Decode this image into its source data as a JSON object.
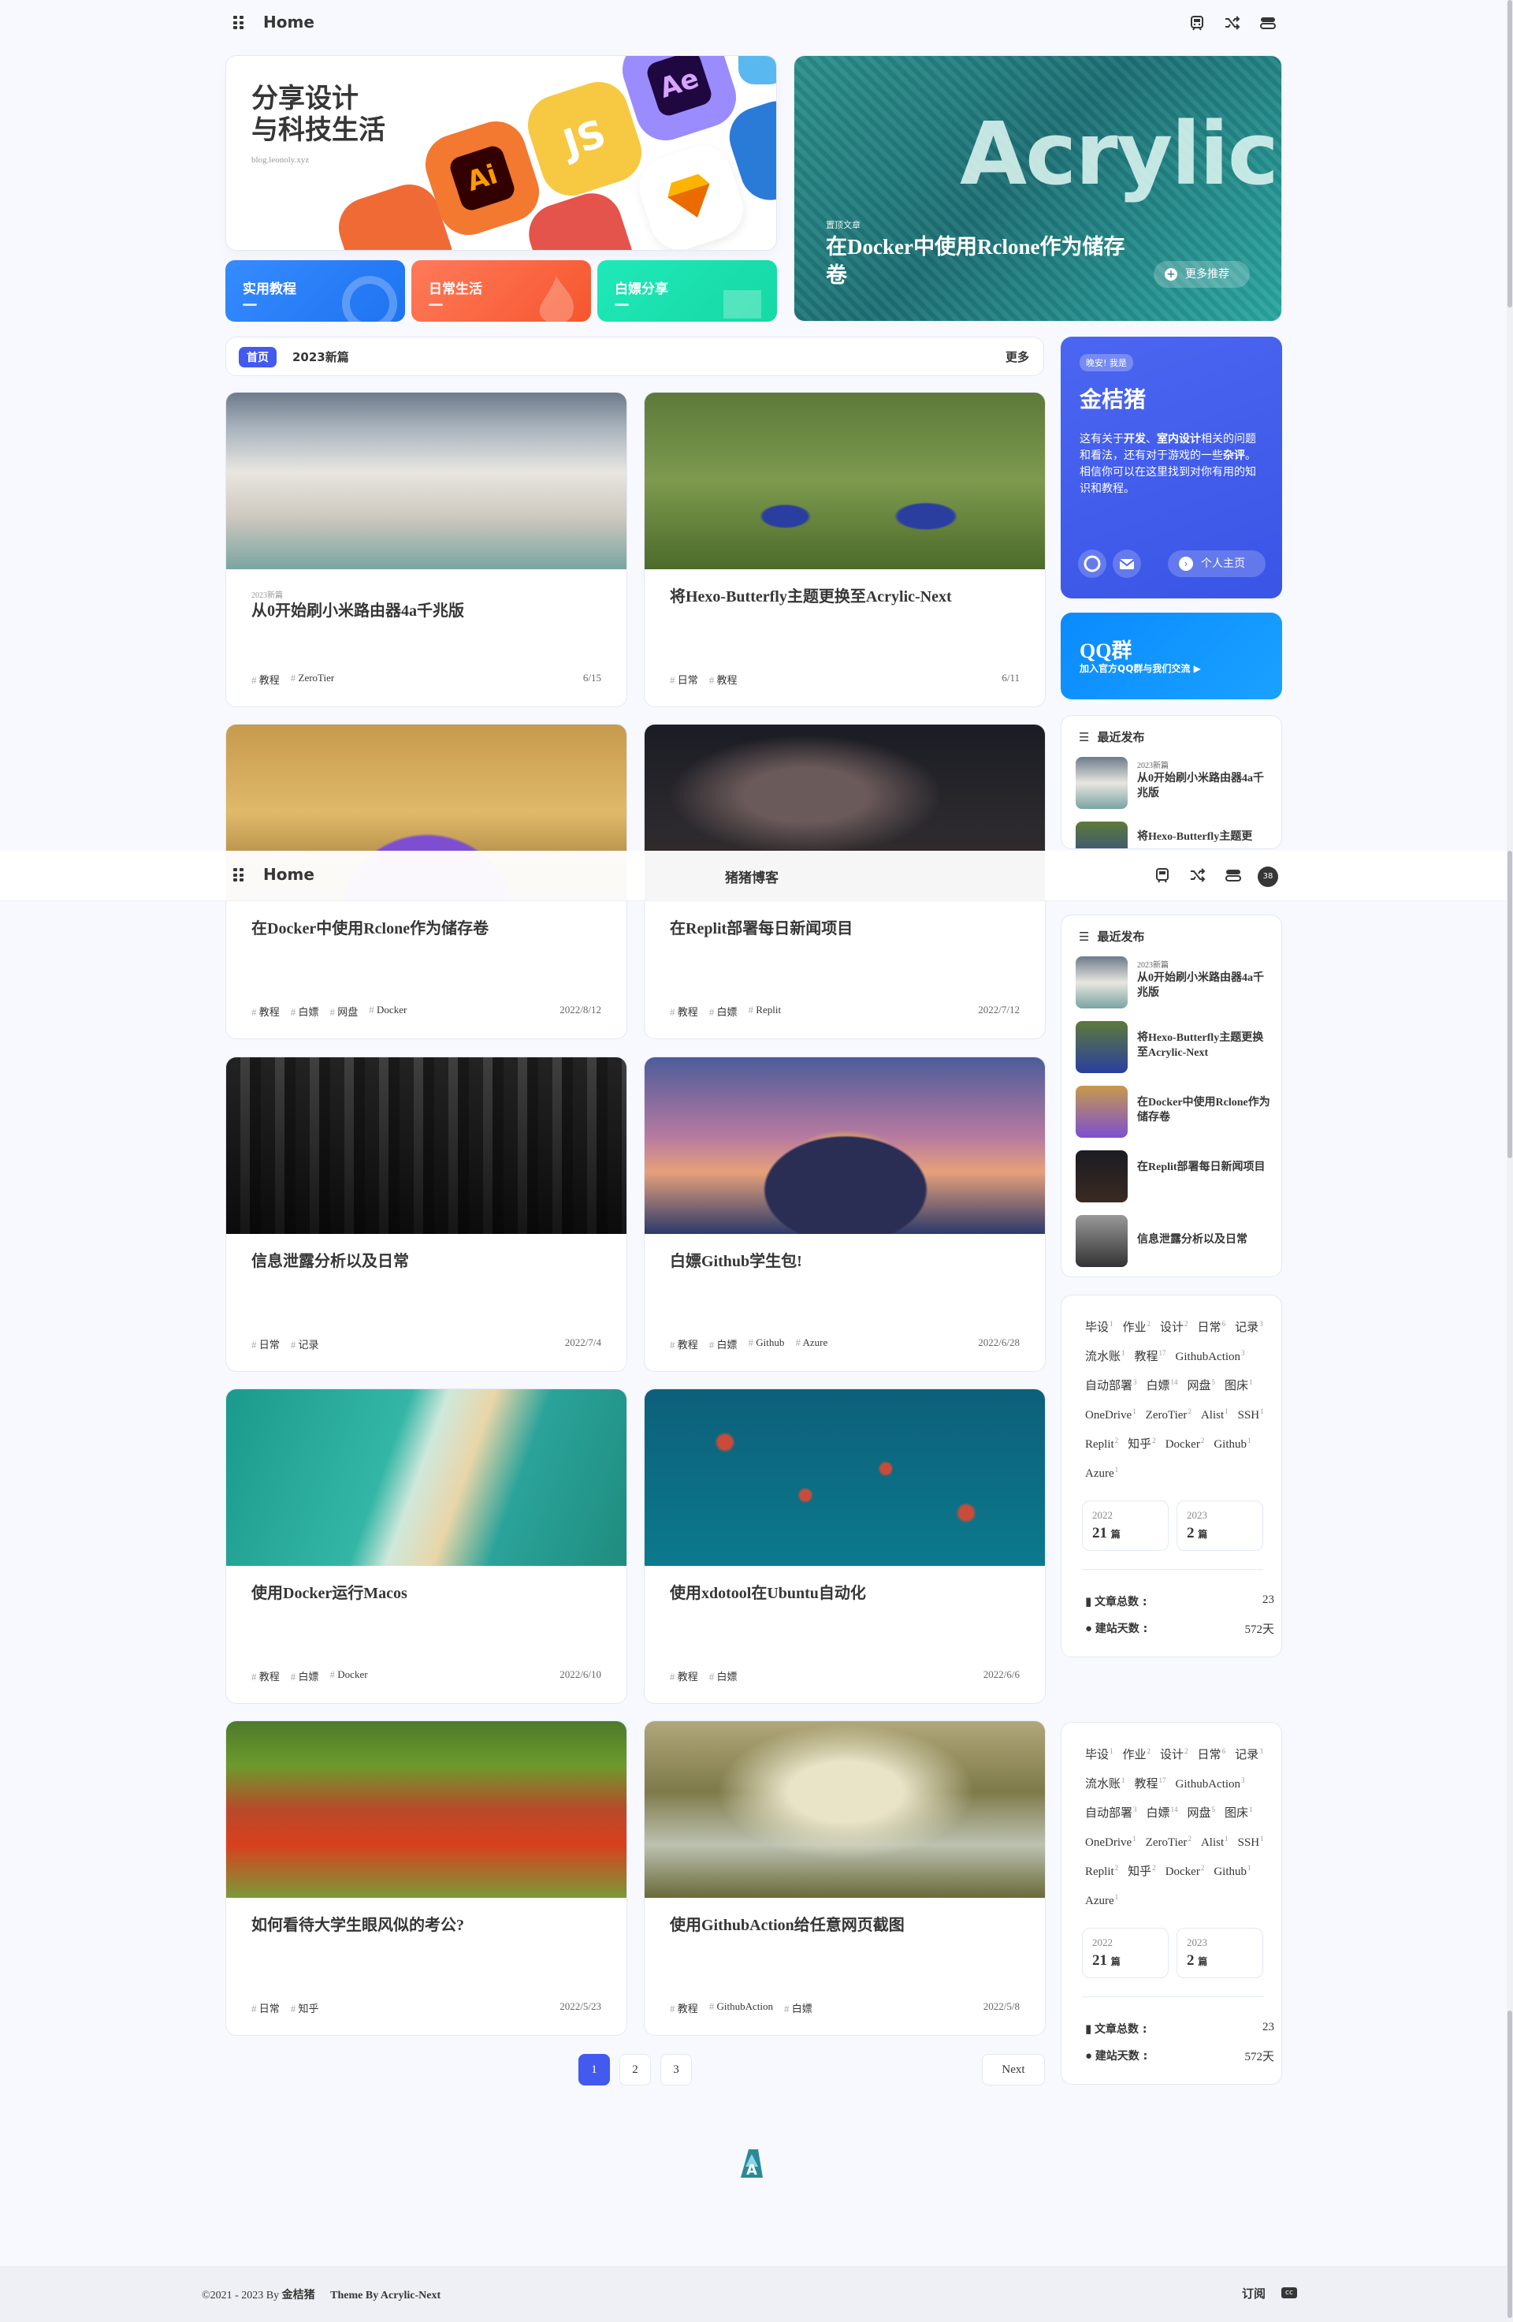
{
  "nav": {
    "brand": "Home",
    "center_title": "猪猪博客",
    "avatar_badge": "38"
  },
  "hero": {
    "title_line1": "分享设计",
    "title_line2": "与科技生活",
    "url": "blog.leonoly.xyz",
    "apps": [
      "Ai",
      "JS",
      "Ae"
    ],
    "categories": [
      "实用教程",
      "日常生活",
      "白嫖分享"
    ]
  },
  "featured": {
    "label": "置顶文章",
    "title": "在Docker中使用Rclone作为储存卷",
    "more_button": "更多推荐",
    "watermark": "Acrylic"
  },
  "catbar": {
    "home": "首页",
    "current": "2023新篇",
    "more": "更多"
  },
  "posts": [
    {
      "category": "2023新篇",
      "title": "从0开始刷小米路由器4a千兆版",
      "tags": [
        "教程",
        "ZeroTier"
      ],
      "date": "6/15"
    },
    {
      "category": "",
      "title": "将Hexo-Butterfly主题更换至Acrylic-Next",
      "tags": [
        "日常",
        "教程"
      ],
      "date": "6/11"
    },
    {
      "category": "",
      "title": "在Docker中使用Rclone作为储存卷",
      "tags": [
        "教程",
        "白嫖",
        "网盘",
        "Docker"
      ],
      "date": "2022/8/12"
    },
    {
      "category": "",
      "title": "在Replit部署每日新闻项目",
      "tags": [
        "教程",
        "白嫖",
        "Replit"
      ],
      "date": "2022/7/12"
    },
    {
      "category": "",
      "title": "信息泄露分析以及日常",
      "tags": [
        "日常",
        "记录"
      ],
      "date": "2022/7/4"
    },
    {
      "category": "",
      "title": "白嫖Github学生包!",
      "tags": [
        "教程",
        "白嫖",
        "Github",
        "Azure"
      ],
      "date": "2022/6/28"
    },
    {
      "category": "",
      "title": "使用Docker运行Macos",
      "tags": [
        "教程",
        "白嫖",
        "Docker"
      ],
      "date": "2022/6/10"
    },
    {
      "category": "",
      "title": "使用xdotool在Ubuntu自动化",
      "tags": [
        "教程",
        "白嫖"
      ],
      "date": "2022/6/6"
    },
    {
      "category": "",
      "title": "如何看待大学生眼风似的考公?",
      "tags": [
        "日常",
        "知乎"
      ],
      "date": "2022/5/23"
    },
    {
      "category": "",
      "title": "使用GithubAction给任意网页截图",
      "tags": [
        "教程",
        "GithubAction",
        "白嫖"
      ],
      "date": "2022/5/8"
    }
  ],
  "author": {
    "greeting": "晚安! 我是",
    "name": "金桔猪",
    "desc_1": "这有关于",
    "desc_bold1": "开发",
    "desc_2": "、",
    "desc_bold2": "室内设计",
    "desc_3": "相关的问题和看法，还有对于游戏的一些",
    "desc_bold3": "杂评",
    "desc_4": "。",
    "desc_5": "相信你可以在这里找到对你有用的知识和教程。",
    "home_button": "个人主页"
  },
  "qq": {
    "title": "QQ群",
    "subtitle": "加入官方QQ群与我们交流 ▶"
  },
  "recent": {
    "title": "最近发布",
    "items": [
      {
        "category": "2023新篇",
        "title": "从0开始刷小米路由器4a千兆版"
      },
      {
        "category": "",
        "title": "将Hexo-Butterfly主题更换至Acrylic-Next"
      },
      {
        "category": "",
        "title": "在Docker中使用Rclone作为储存卷"
      },
      {
        "category": "",
        "title": "在Replit部署每日新闻项目"
      },
      {
        "category": "",
        "title": "信息泄露分析以及日常"
      }
    ],
    "partial_title_top": "将Hexo-Butterfly主题更"
  },
  "tags": [
    {
      "name": "毕设",
      "count": "1"
    },
    {
      "name": "作业",
      "count": "2"
    },
    {
      "name": "设计",
      "count": "2"
    },
    {
      "name": "日常",
      "count": "6"
    },
    {
      "name": "记录",
      "count": "3"
    },
    {
      "name": "流水账",
      "count": "1"
    },
    {
      "name": "教程",
      "count": "17"
    },
    {
      "name": "GithubAction",
      "count": "3"
    },
    {
      "name": "自动部署",
      "count": "3"
    },
    {
      "name": "白嫖",
      "count": "14"
    },
    {
      "name": "网盘",
      "count": "5"
    },
    {
      "name": "图床",
      "count": "1"
    },
    {
      "name": "OneDrive",
      "count": "1"
    },
    {
      "name": "ZeroTier",
      "count": "2"
    },
    {
      "name": "Alist",
      "count": "1"
    },
    {
      "name": "SSH",
      "count": "1"
    },
    {
      "name": "Replit",
      "count": "2"
    },
    {
      "name": "知乎",
      "count": "2"
    },
    {
      "name": "Docker",
      "count": "2"
    },
    {
      "name": "Github",
      "count": "1"
    },
    {
      "name": "Azure",
      "count": "1"
    }
  ],
  "archives": [
    {
      "year": "2022",
      "count": "21",
      "unit": "篇"
    },
    {
      "year": "2023",
      "count": "2",
      "unit": "篇"
    }
  ],
  "stats": {
    "posts_label": "文章总数 :",
    "posts_value": "23",
    "days_label": "建站天数 :",
    "days_value": "572天"
  },
  "pagination": {
    "pages": [
      "1",
      "2",
      "3"
    ],
    "next": "Next"
  },
  "footer": {
    "copyright": "©2021 - 2023 By",
    "author": "金桔猪",
    "theme": "Theme By Acrylic-Next",
    "subscribe": "订阅",
    "cc": "cc"
  },
  "colors": {
    "accent": "#425aef",
    "cat1": "#358bff",
    "cat2": "#f65",
    "cat3": "#18e7ae"
  }
}
